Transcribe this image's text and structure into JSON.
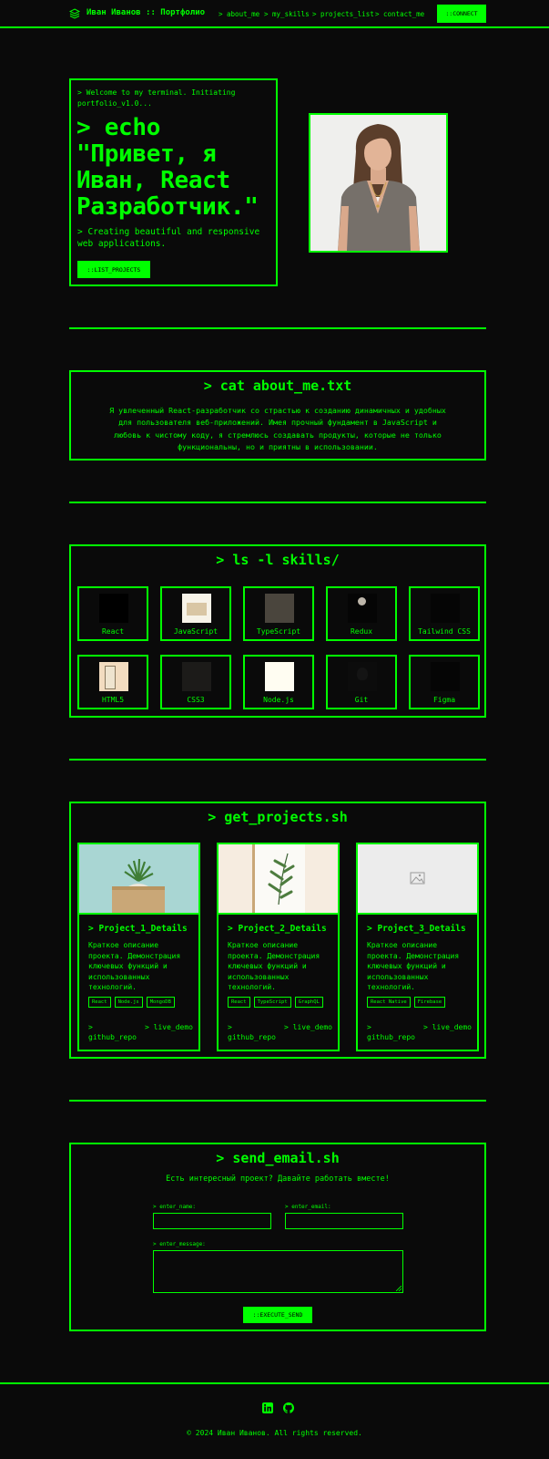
{
  "header": {
    "brand": "Иван Иванов :: Портфолио",
    "nav": [
      "> about_me",
      "> my_skills",
      "> projects_list",
      "> contact_me"
    ],
    "connect_label": "::CONNECT"
  },
  "hero": {
    "welcome": "> Welcome to my terminal. Initiating portfolio_v1.0...",
    "title": "> echo \"Привет, я Иван, React Разработчик.\"",
    "subtitle": "> Creating beautiful and responsive web applications.",
    "button": "::LIST_PROJECTS"
  },
  "about": {
    "title": "> cat about_me.txt",
    "text": "Я увлеченный React-разработчик со страстью к созданию динамичных и удобных для пользователя веб-приложений. Имея прочный фундамент в JavaScript и любовь к чистому коду, я стремлюсь создавать продукты, которые не только функциональны, но и приятны в использовании."
  },
  "skills": {
    "title": "> ls -l skills/",
    "items": [
      "React",
      "JavaScript",
      "TypeScript",
      "Redux",
      "Tailwind CSS",
      "HTML5",
      "CSS3",
      "Node.js",
      "Git",
      "Figma"
    ]
  },
  "projects": {
    "title": "> get_projects.sh",
    "items": [
      {
        "title": "> Project_1_Details",
        "desc": "Краткое описание проекта. Демонстрация ключевых функций и использованных технологий.",
        "tags": [
          "React",
          "Node.js",
          "MongoDB"
        ],
        "repo": "> github_repo",
        "demo": "> live_demo"
      },
      {
        "title": "> Project_2_Details",
        "desc": "Краткое описание проекта. Демонстрация ключевых функций и использованных технологий.",
        "tags": [
          "React",
          "TypeScript",
          "GraphQL"
        ],
        "repo": "> github_repo",
        "demo": "> live_demo"
      },
      {
        "title": "> Project_3_Details",
        "desc": "Краткое описание проекта. Демонстрация ключевых функций и использованных технологий.",
        "tags": [
          "React Native",
          "Firebase"
        ],
        "repo": "> github_repo",
        "demo": "> live_demo"
      }
    ]
  },
  "contact": {
    "title": "> send_email.sh",
    "subtitle": "Есть интересный проект? Давайте работать вместе!",
    "name_label": "> enter_name:",
    "email_label": "> enter_email:",
    "message_label": "> enter_message:",
    "send_label": "::EXECUTE_SEND"
  },
  "footer": {
    "icons": [
      "linkedin-icon",
      "github-icon"
    ],
    "copyright": "© 2024 Иван Иванов. All rights reserved."
  },
  "colors": {
    "accent": "#00ff00",
    "background": "#0a0a0a"
  }
}
